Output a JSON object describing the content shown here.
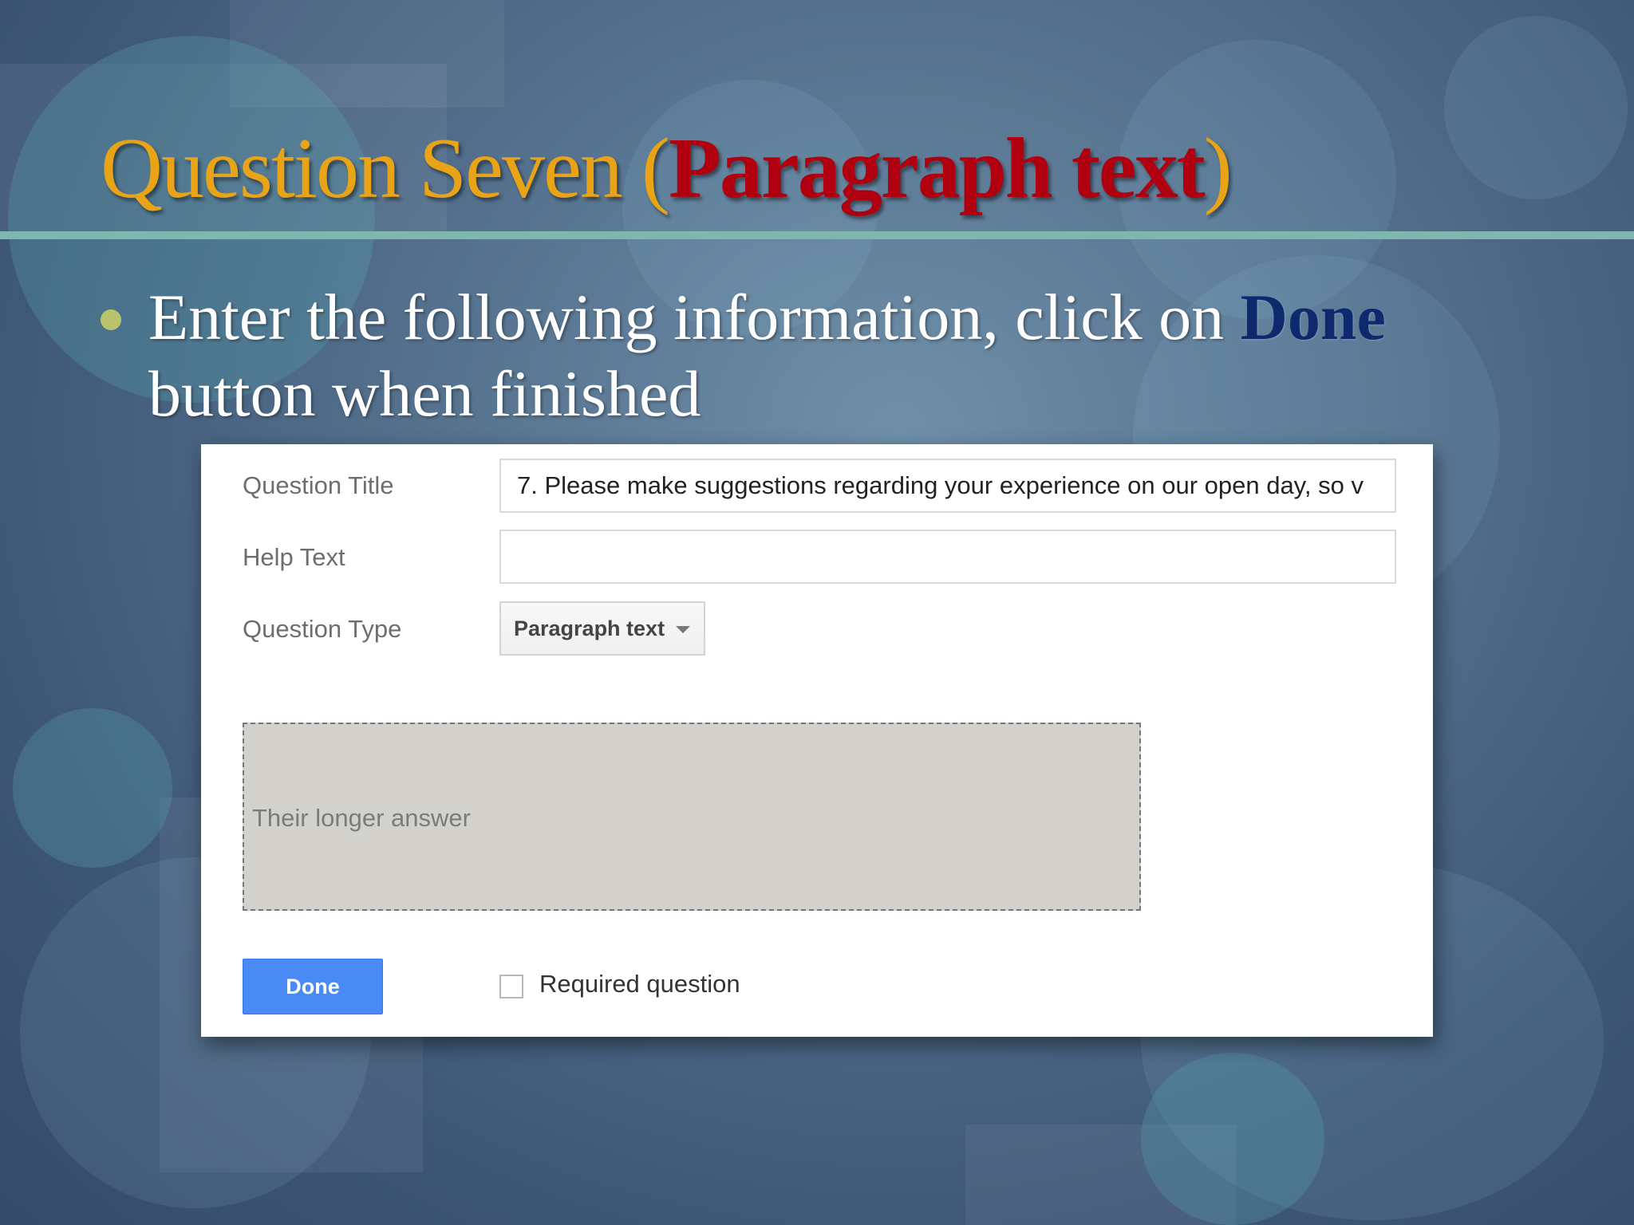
{
  "slide": {
    "title_prefix": "Question Seven (",
    "title_highlight": "Paragraph text",
    "title_suffix": ")",
    "bullet_text": "Enter the following information, click on ",
    "bullet_highlight": "Done",
    "bullet_text_end": " button when finished"
  },
  "form": {
    "question_title_label": "Question Title",
    "question_title_value": "7. Please make suggestions regarding your experience on our open day, so v",
    "help_text_label": "Help Text",
    "help_text_value": "",
    "question_type_label": "Question Type",
    "question_type_selected": "Paragraph text",
    "preview_placeholder": "Their longer answer",
    "done_label": "Done",
    "required_label": "Required question",
    "required_checked": false
  },
  "colors": {
    "title_gold": "#e8a317",
    "title_red": "#b00010",
    "done_blue": "#4a8af4",
    "rule_teal": "#7fb7b0"
  }
}
